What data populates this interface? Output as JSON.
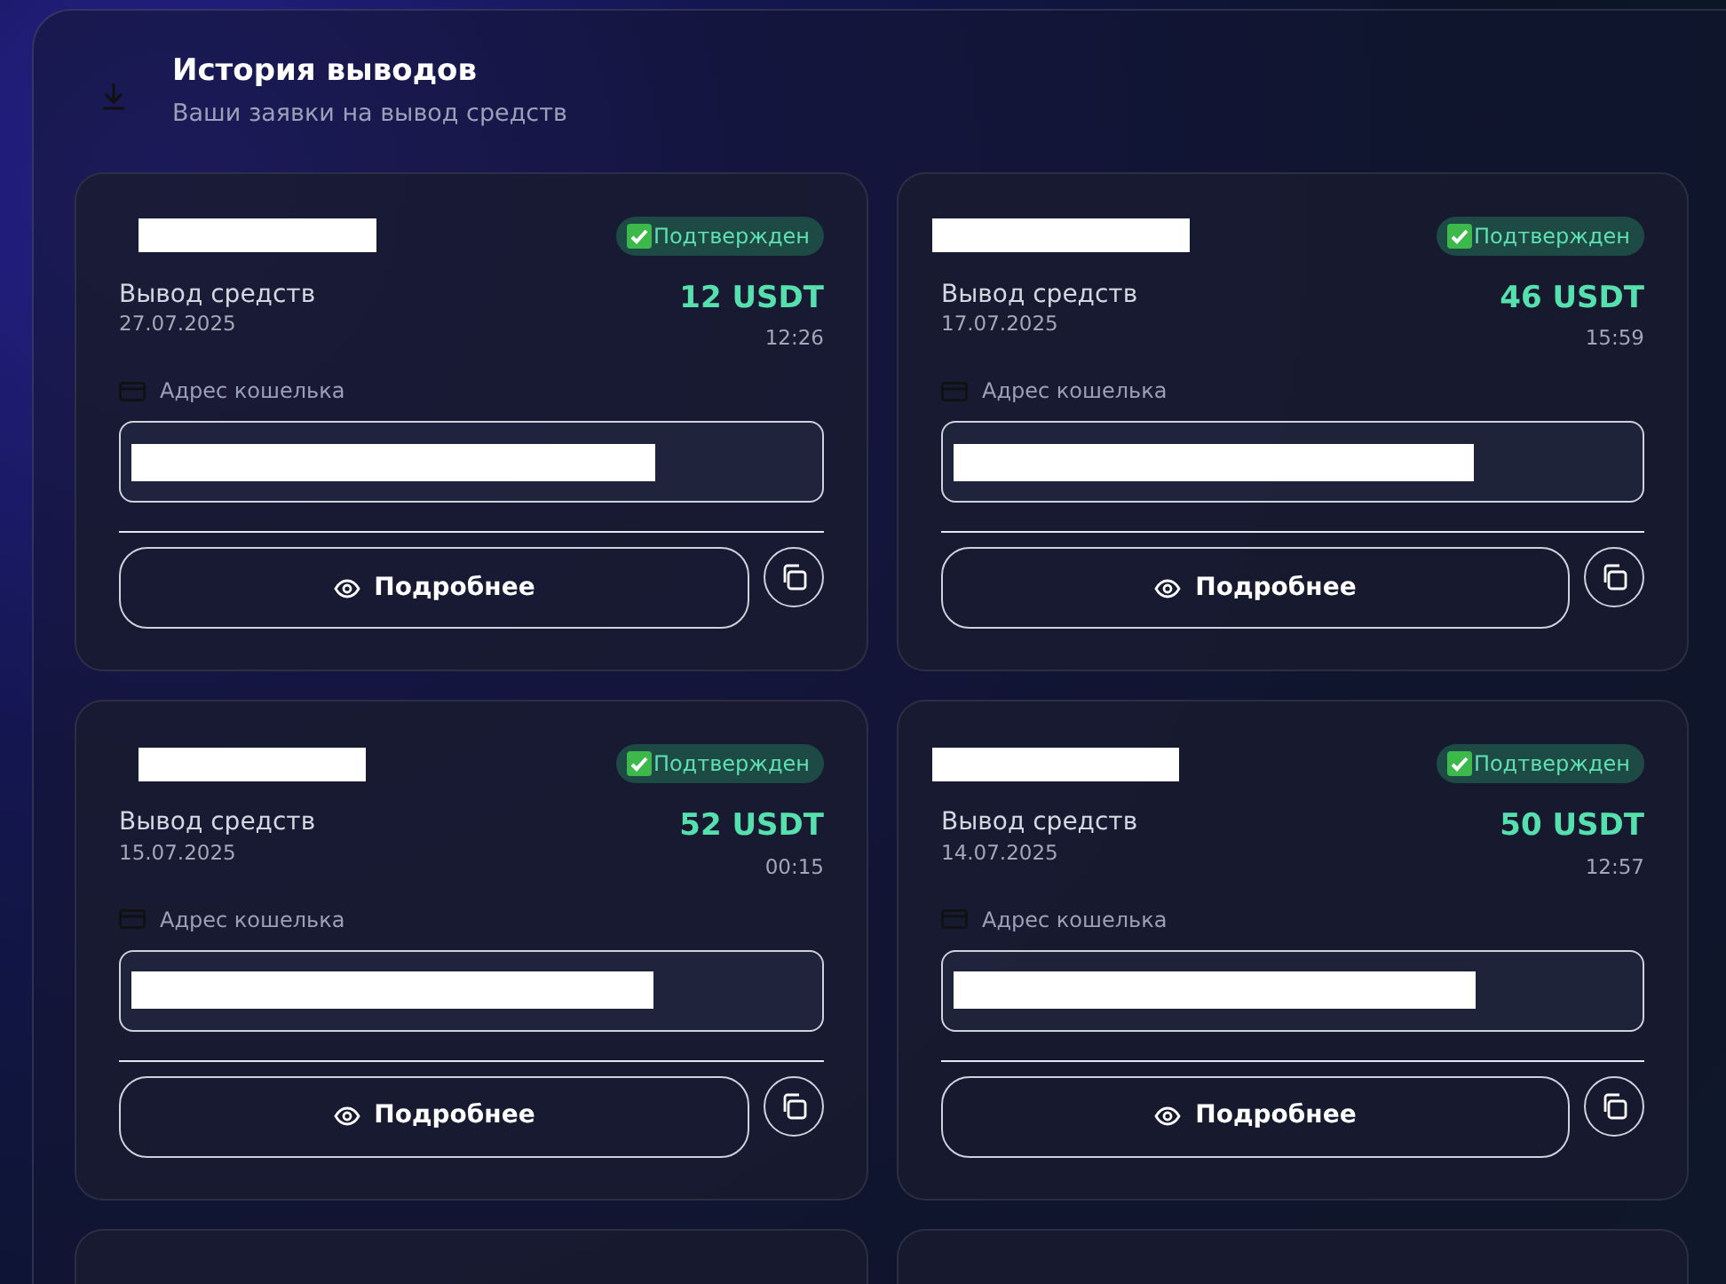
{
  "panel": {
    "title": "История выводов",
    "subtitle": "Ваши заявки на вывод средств"
  },
  "withdrawals": [
    {
      "status": {
        "kind": "confirmed",
        "text": "Подтвержден"
      },
      "label": "Вывод средств",
      "date": "27.07.2025",
      "amount": "12 USDT",
      "time": "12:26",
      "wallet_label": "Адрес кошелька",
      "details_button": "Подробнее"
    },
    {
      "status": {
        "kind": "confirmed",
        "text": "Подтвержден"
      },
      "label": "Вывод средств",
      "date": "17.07.2025",
      "amount": "46 USDT",
      "time": "15:59",
      "wallet_label": "Адрес кошелька",
      "details_button": "Подробнее"
    },
    {
      "status": {
        "kind": "confirmed",
        "text": "Подтвержден"
      },
      "label": "Вывод средств",
      "date": "15.07.2025",
      "amount": "52 USDT",
      "time": "00:15",
      "wallet_label": "Адрес кошелька",
      "details_button": "Подробнее"
    },
    {
      "status": {
        "kind": "confirmed",
        "text": "Подтвержден"
      },
      "label": "Вывод средств",
      "date": "14.07.2025",
      "amount": "50 USDT",
      "time": "12:57",
      "wallet_label": "Адрес кошелька",
      "details_button": "Подробнее"
    }
  ]
}
